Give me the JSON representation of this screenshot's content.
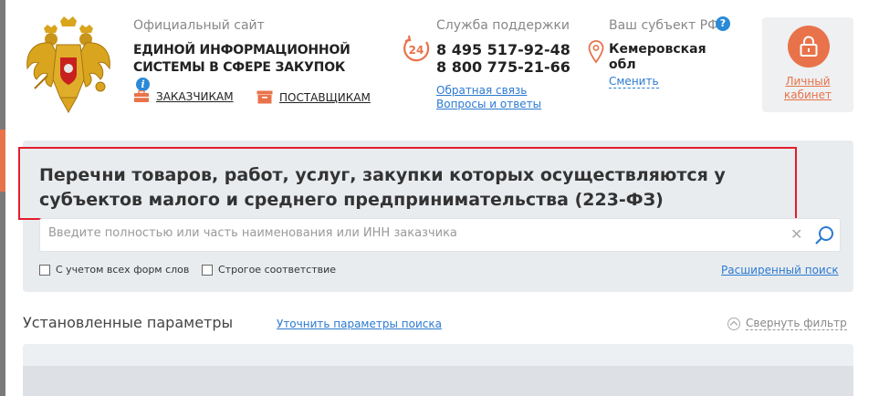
{
  "header": {
    "site_label": "Официальный сайт",
    "site_name_line1": "ЕДИНОЙ ИНФОРМАЦИОННОЙ",
    "site_name_line2": "СИСТЕМЫ В СФЕРЕ ЗАКУПОК",
    "info_icon_glyph": "i",
    "nav": {
      "customers": "ЗАКАЗЧИКАМ",
      "suppliers": "ПОСТАВЩИКАМ"
    }
  },
  "support": {
    "label": "Служба поддержки",
    "badge": "24",
    "phone1": "8 495 517-92-48",
    "phone2": "8 800 775-21-66",
    "feedback": "Обратная связь",
    "faq": "Вопросы и ответы"
  },
  "region": {
    "label": "Ваш субъект РФ",
    "help_glyph": "?",
    "name_line1": "Кемеровская",
    "name_line2": "обл",
    "change": "Сменить"
  },
  "cabinet": {
    "line1": "Личный",
    "line2": "кабинет"
  },
  "search": {
    "title_line1": "Перечни товаров, работ, услуг, закупки которых осуществляются у",
    "title_line2": "субъектов малого и среднего предпринимательства (223-ФЗ)",
    "placeholder": "Введите полностью или часть наименования или ИНН заказчика",
    "value": "",
    "clear_glyph": "✕",
    "option_all_forms": "С учетом всех форм слов",
    "option_strict": "Строгое соответствие",
    "advanced": "Расширенный поиск"
  },
  "params": {
    "title": "Установленные параметры",
    "refine": "Уточнить параметры поиска",
    "collapse": "Свернуть фильтр"
  },
  "icons": {
    "logo": "russian-coat-of-arms",
    "customers": "briefcase-icon",
    "suppliers": "box-icon",
    "support": "clock-24-icon",
    "region": "map-pin-icon",
    "cabinet": "lock-icon",
    "search": "magnifier-icon"
  },
  "colors": {
    "accent": "#e8734a",
    "link": "#2b7ad0",
    "info": "#2b8ad8",
    "highlight_border": "#e21e2a",
    "panel": "#e9ecef"
  }
}
